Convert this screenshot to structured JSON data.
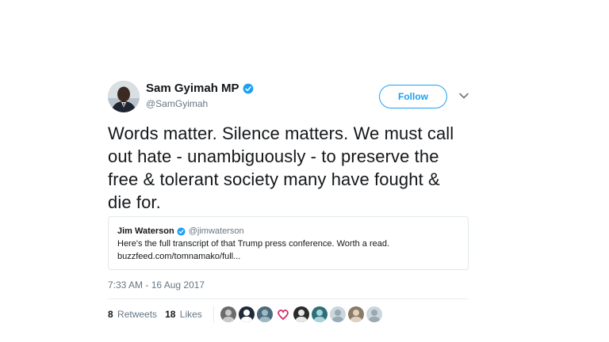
{
  "author": {
    "display_name": "Sam Gyimah MP",
    "handle": "@SamGyimah",
    "verified_icon": "verified-badge-icon",
    "avatar_icon": "avatar"
  },
  "actions": {
    "follow_label": "Follow",
    "menu_icon": "chevron-down-icon"
  },
  "tweet": {
    "text": "Words matter. Silence matters. We must call out hate - unambiguously - to preserve the free & tolerant society many have fought & die for.",
    "timestamp": "7:33 AM - 16 Aug 2017"
  },
  "quote": {
    "display_name": "Jim Waterson",
    "handle": "@jimwaterson",
    "text": "Here's the full transcript of that Trump press conference. Worth a read.",
    "link": "buzzfeed.com/tomnamako/full..."
  },
  "stats": {
    "retweets_count": "8",
    "retweets_label": "Retweets",
    "likes_count": "18",
    "likes_label": "Likes"
  },
  "likers": [
    {
      "color": "#6b6b6b",
      "accent": "#c9c9c9"
    },
    {
      "color": "#1f2a3a",
      "accent": "#ffffff"
    },
    {
      "color": "#4a6b7c",
      "accent": "#9fb8c4"
    },
    {
      "color": "#ffffff",
      "accent": "#d6306a"
    },
    {
      "color": "#2b2b2b",
      "accent": "#e8e8e8"
    },
    {
      "color": "#2d6f79",
      "accent": "#a8d3d8"
    },
    {
      "color": "#ccd6dd",
      "accent": "#9aa9b4"
    },
    {
      "color": "#8a7a66",
      "accent": "#e0d2c0"
    },
    {
      "color": "#ccd6dd",
      "accent": "#9aa9b4"
    }
  ],
  "colors": {
    "brand_blue": "#1da1f2",
    "text_primary": "#14171a",
    "text_secondary": "#657786",
    "border": "#e1e8ed"
  }
}
